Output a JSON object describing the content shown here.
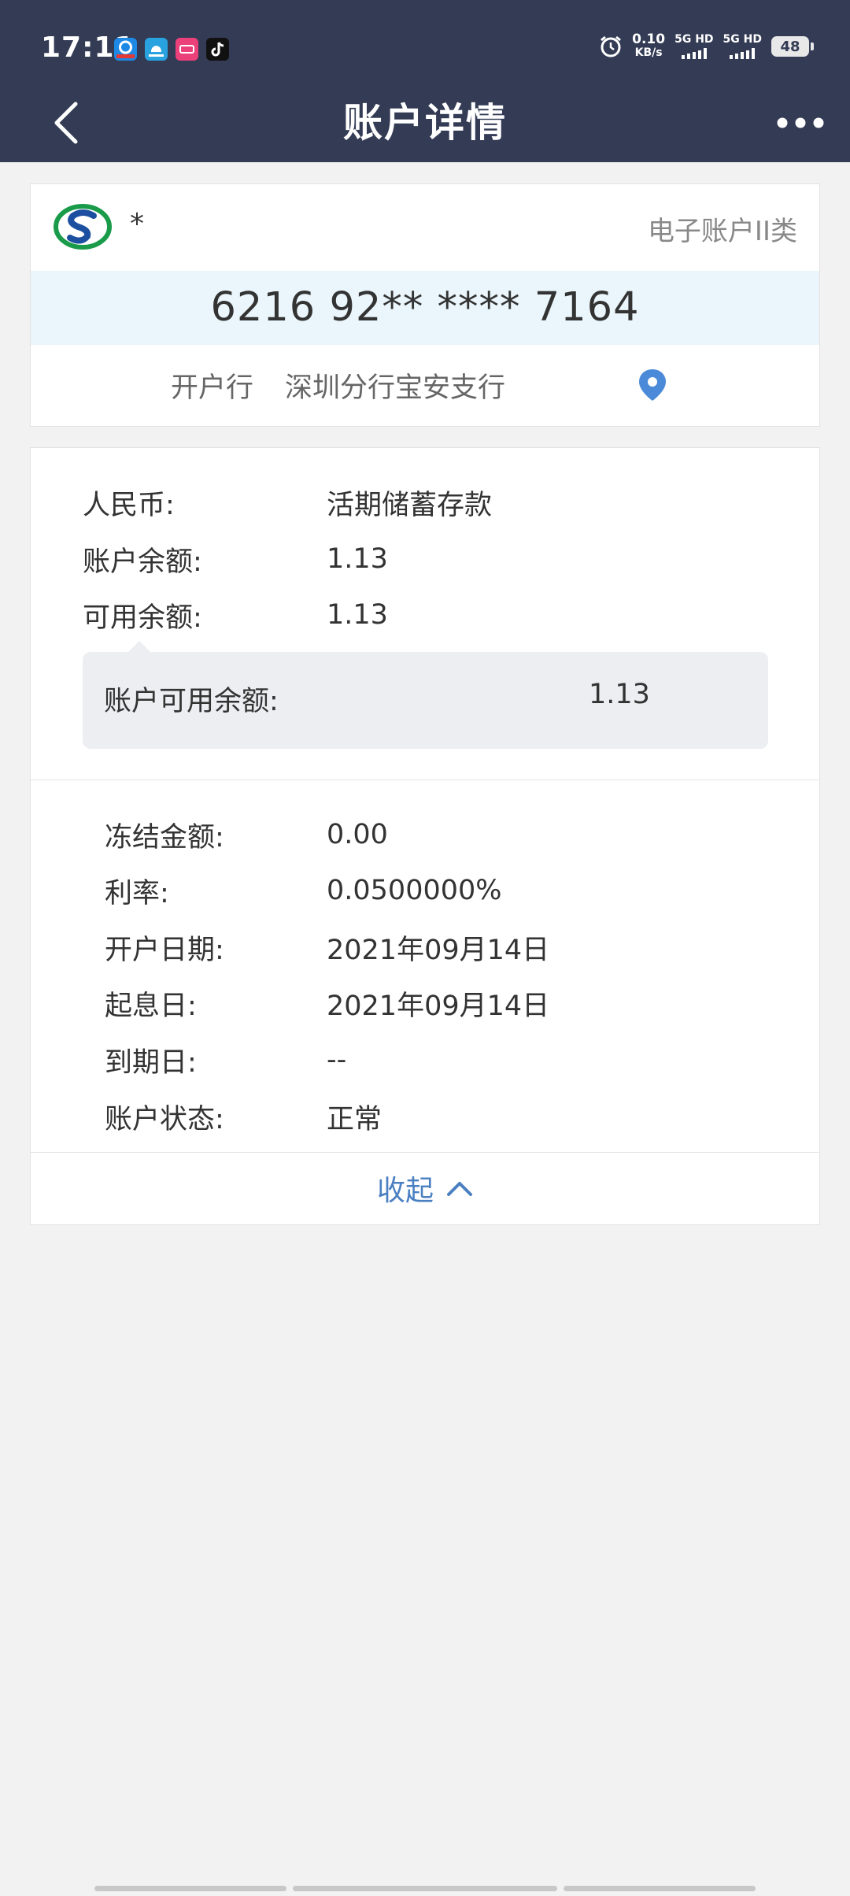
{
  "status_bar": {
    "time": "17:11",
    "app_icons": [
      "e-cart-app-icon",
      "cloud-app-icon",
      "lala-app-icon",
      "tiktok-app-icon"
    ],
    "net_speed_value": "0.10",
    "net_speed_unit": "KB/s",
    "sim1_label": "5G HD",
    "sim2_label": "5G HD",
    "battery": "48"
  },
  "header": {
    "title": "账户详情"
  },
  "account_card": {
    "bank_name": "*",
    "account_type": "电子账户II类",
    "card_number": "6216 92** **** 7164",
    "branch_label": "开户行",
    "branch_value": "深圳分行宝安支行"
  },
  "details": {
    "currency_label": "人民币:",
    "currency_value": "活期储蓄存款",
    "balance_label": "账户余额:",
    "balance_value": "1.13",
    "available_label": "可用余额:",
    "available_value": "1.13",
    "available_box_label": "账户可用余额:",
    "available_box_value": "1.13",
    "frozen_label": "冻结金额:",
    "frozen_value": "0.00",
    "rate_label": "利率:",
    "rate_value": "0.0500000%",
    "open_date_label": "开户日期:",
    "open_date_value": "2021年09月14日",
    "interest_start_label": "起息日:",
    "interest_start_value": "2021年09月14日",
    "maturity_label": "到期日:",
    "maturity_value": "--",
    "status_label": "账户状态:",
    "status_value": "正常"
  },
  "collapse": {
    "label": "收起"
  },
  "colors": {
    "header_bg": "#333b55",
    "page_bg": "#f2f2f2",
    "card_number_bg": "#eaf6fb",
    "accent_blue": "#4a7fc1",
    "available_box_bg": "#eceef1"
  }
}
